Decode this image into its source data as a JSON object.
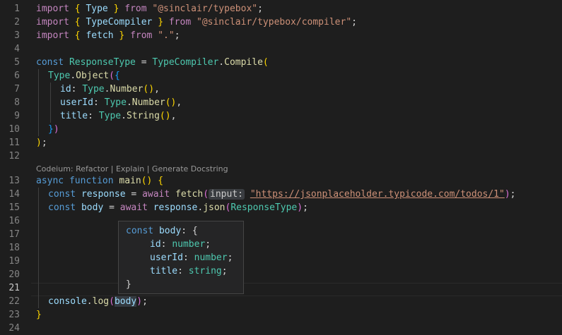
{
  "gutter": {
    "line_numbers": [
      "1",
      "2",
      "3",
      "4",
      "5",
      "6",
      "7",
      "8",
      "9",
      "10",
      "11",
      "12",
      "13",
      "14",
      "15",
      "16",
      "17",
      "18",
      "19",
      "20",
      "21",
      "22",
      "23",
      "24"
    ],
    "active_line": "21"
  },
  "codelens": {
    "text": "Codeium: Refactor | Explain | Generate Docstring"
  },
  "code": {
    "l1": {
      "kw": "import",
      "brace_open": "{",
      "name": "Type",
      "brace_close": "}",
      "from": "from",
      "module": "\"@sinclair/typebox\"",
      "semi": ";"
    },
    "l2": {
      "kw": "import",
      "brace_open": "{",
      "name": "TypeCompiler",
      "brace_close": "}",
      "from": "from",
      "module": "\"@sinclair/typebox/compiler\"",
      "semi": ";"
    },
    "l3": {
      "kw": "import",
      "brace_open": "{",
      "name": "fetch",
      "brace_close": "}",
      "from": "from",
      "module": "\".\"",
      "semi": ";"
    },
    "l5": {
      "kw": "const",
      "name": "ResponseType",
      "eq": "=",
      "cls": "TypeCompiler",
      "dot": ".",
      "fn": "Compile",
      "paren": "("
    },
    "l6": {
      "cls": "Type",
      "dot": ".",
      "fn": "Object",
      "paren": "(",
      "brace": "{"
    },
    "l7": {
      "key": "id",
      "colon": ":",
      "cls": "Type",
      "dot": ".",
      "fn": "Number",
      "parens": "()",
      "comma": ","
    },
    "l8": {
      "key": "userId",
      "colon": ":",
      "cls": "Type",
      "dot": ".",
      "fn": "Number",
      "parens": "()",
      "comma": ","
    },
    "l9": {
      "key": "title",
      "colon": ":",
      "cls": "Type",
      "dot": ".",
      "fn": "String",
      "parens": "()",
      "comma": ","
    },
    "l10": {
      "brace": "}",
      "paren": ")"
    },
    "l11": {
      "paren": ")",
      "semi": ";"
    },
    "l13": {
      "async": "async",
      "function": "function",
      "fn": "main",
      "parens": "()",
      "brace": "{"
    },
    "l14": {
      "kw": "const",
      "name": "response",
      "eq": "=",
      "await": "await",
      "fn": "fetch",
      "paren_open": "(",
      "hint": "input:",
      "url": "\"https://jsonplaceholder.typicode.com/todos/1\"",
      "paren_close": ")",
      "semi": ";"
    },
    "l15": {
      "kw": "const",
      "name": "body",
      "eq": "=",
      "await": "await",
      "obj": "response",
      "dot": ".",
      "fn": "json",
      "paren_open": "(",
      "arg": "ResponseType",
      "paren_close": ")",
      "semi": ";"
    },
    "l22": {
      "obj": "console",
      "dot": ".",
      "fn": "log",
      "paren_open": "(",
      "arg": "body",
      "paren_close": ")",
      "semi": ";"
    },
    "l23": {
      "brace": "}"
    }
  },
  "hover": {
    "header_kw": "const",
    "header_name": "body",
    "header_rest": ": {",
    "fields": [
      {
        "name": "id",
        "type": "number"
      },
      {
        "name": "userId",
        "type": "number"
      },
      {
        "name": "title",
        "type": "string"
      }
    ],
    "close": "}"
  },
  "colors": {
    "background": "#1e1e1e",
    "keyword": "#569cd6",
    "control_keyword": "#c586c0",
    "variable": "#9cdcfe",
    "type": "#4ec9b0",
    "function": "#dcdcaa",
    "string": "#ce9178"
  }
}
